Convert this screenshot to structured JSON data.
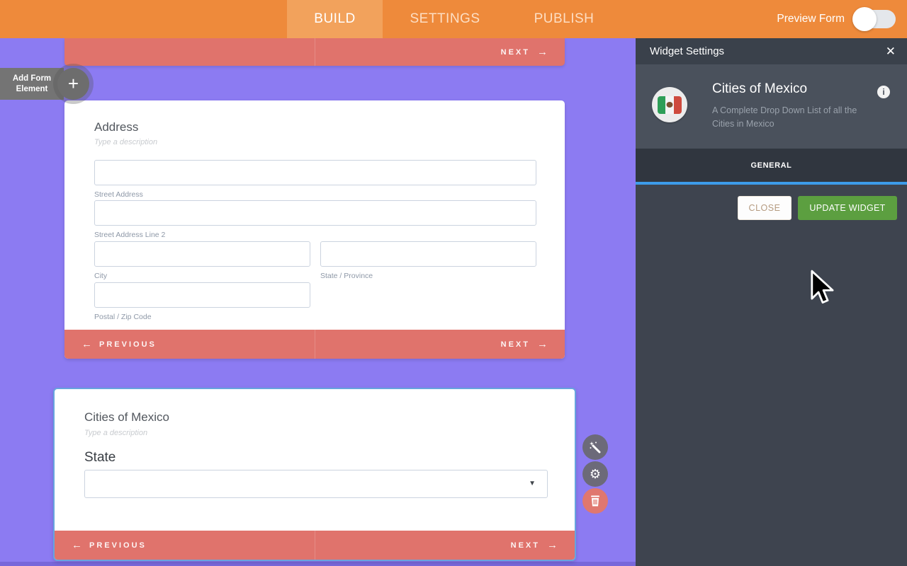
{
  "header": {
    "tabs": [
      {
        "label": "BUILD",
        "active": true
      },
      {
        "label": "SETTINGS",
        "active": false
      },
      {
        "label": "PUBLISH",
        "active": false
      }
    ],
    "preview_toggle": {
      "label": "Preview Form",
      "state": "off"
    }
  },
  "canvas": {
    "add_element_button": {
      "line1": "Add Form",
      "line2": "Element"
    },
    "pager": {
      "previous": "PREVIOUS",
      "next": "NEXT",
      "arrow_left": "←",
      "arrow_right": "→"
    },
    "address_card": {
      "title": "Address",
      "description_placeholder": "Type a description",
      "labels": {
        "street": "Street Address",
        "street2": "Street Address Line 2",
        "city": "City",
        "state": "State / Province",
        "postal": "Postal / Zip Code"
      }
    },
    "widget_card": {
      "title": "Cities of Mexico",
      "description_placeholder": "Type a description",
      "field_label": "State"
    }
  },
  "panel": {
    "title": "Widget Settings",
    "widget": {
      "name": "Cities of Mexico",
      "description": "A Complete Drop Down List of all the Cities in Mexico"
    },
    "tab_label": "GENERAL",
    "close_button": "CLOSE",
    "update_button": "UPDATE WIDGET"
  },
  "icons": {
    "plus": "+",
    "close_x": "✕",
    "info": "i",
    "caret_down": "▼"
  },
  "colors": {
    "header_orange": "#EE8A3B",
    "active_tab_orange": "#F2A25C",
    "canvas_purple": "#8C7BF2",
    "pager_salmon": "#E0736C",
    "selected_card_border_blue": "#67A4DE",
    "panel_dark": "#3E444F",
    "panel_section": "#4A515C",
    "panel_tab_dark": "#30363F",
    "accent_blue": "#3D9BE9",
    "update_green": "#5C9F40",
    "trash_red": "#E0776F"
  }
}
